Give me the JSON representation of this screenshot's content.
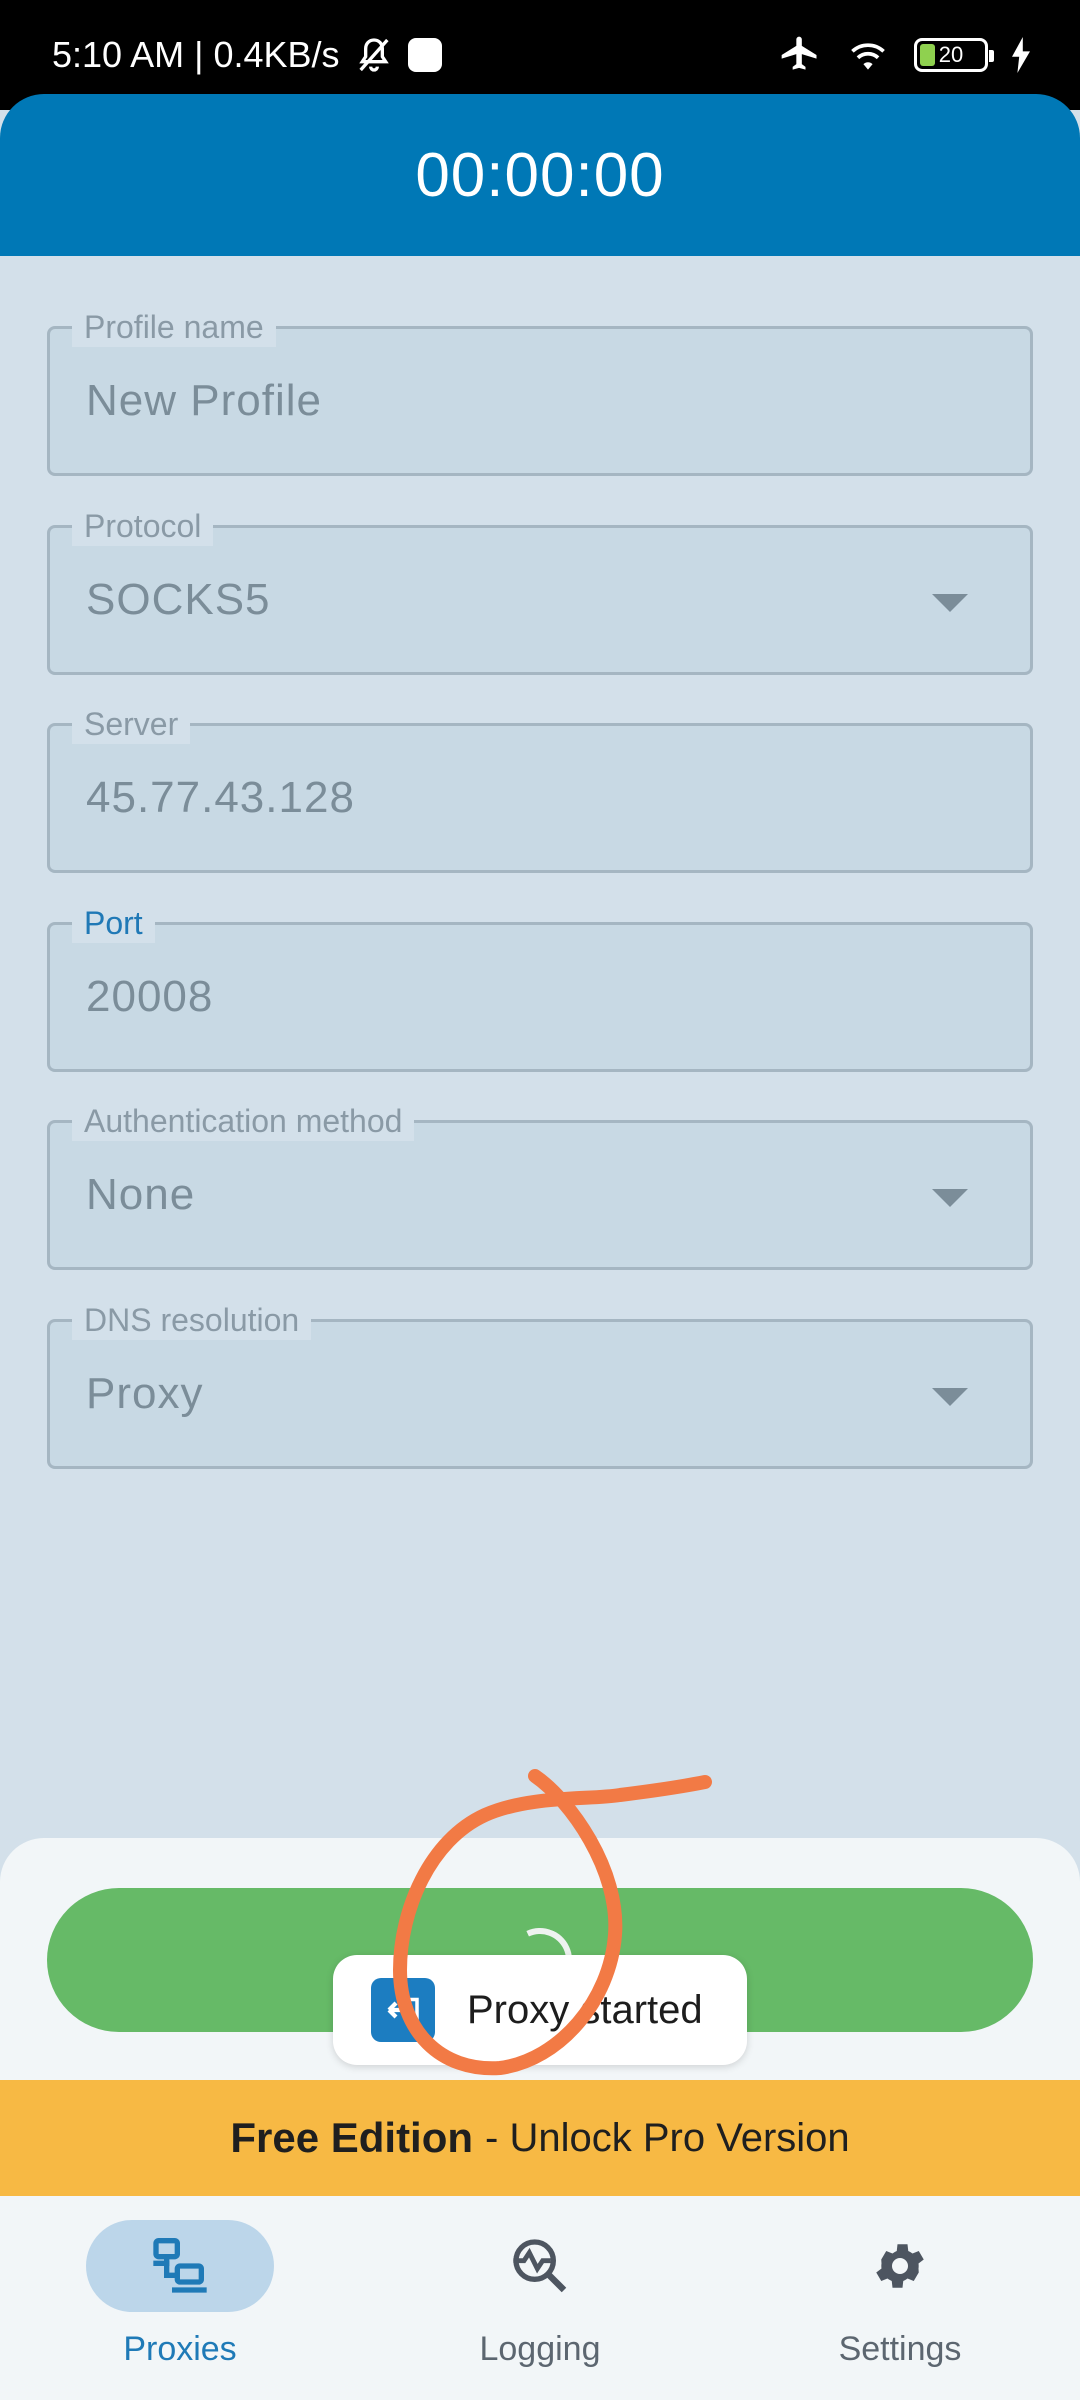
{
  "status_bar": {
    "time_and_speed": "5:10 AM | 0.4KB/s",
    "battery": "20"
  },
  "header": {
    "timer": "00:00:00"
  },
  "form": {
    "profile_name": {
      "label": "Profile name",
      "value": "New Profile"
    },
    "protocol": {
      "label": "Protocol",
      "value": "SOCKS5"
    },
    "server": {
      "label": "Server",
      "value": "45.77.43.128"
    },
    "port": {
      "label": "Port",
      "value": "20008"
    },
    "auth_method": {
      "label": "Authentication method",
      "value": "None"
    },
    "dns_resolution": {
      "label": "DNS resolution",
      "value": "Proxy"
    }
  },
  "toast": {
    "text": "Proxy started"
  },
  "banner": {
    "bold": "Free Edition",
    "rest": "- Unlock Pro Version"
  },
  "nav": {
    "items": [
      {
        "label": "Proxies",
        "icon": "proxies-icon"
      },
      {
        "label": "Logging",
        "icon": "logging-icon"
      },
      {
        "label": "Settings",
        "icon": "gear-icon"
      }
    ],
    "active": "Proxies"
  },
  "colors": {
    "header": "#0078b6",
    "start_button": "#66ba67",
    "banner": "#f7b944",
    "accent": "#1f7ab7",
    "annotation": "#f27a45"
  }
}
